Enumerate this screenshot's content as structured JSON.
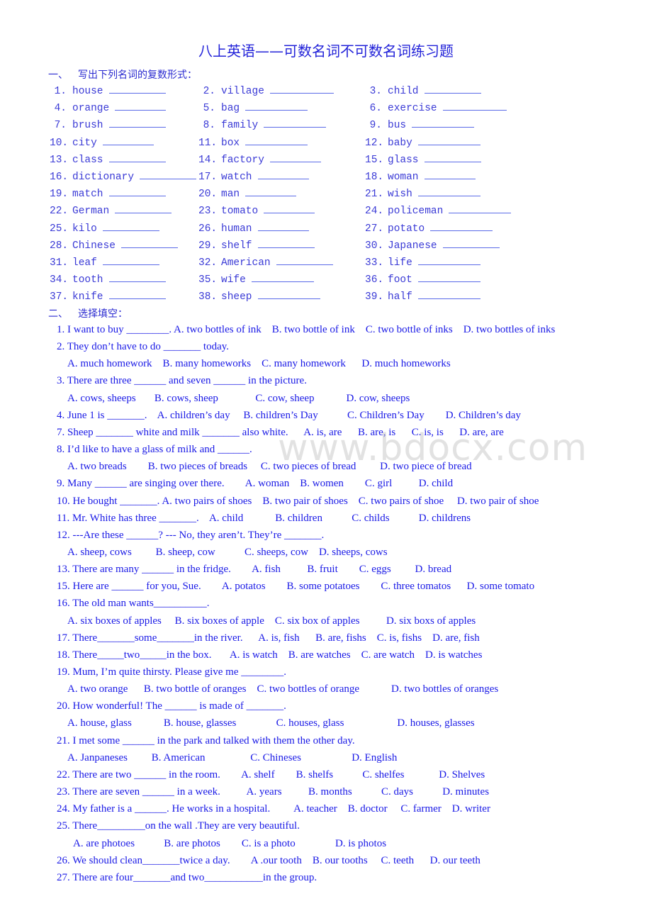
{
  "title": "八上英语——可数名词不可数名词练习题",
  "watermark": "www.bdocx.com",
  "section1": {
    "number": "一、",
    "heading": "写出下列名词的复数形式：",
    "items": [
      {
        "n": "1.",
        "word": "house"
      },
      {
        "n": "2.",
        "word": "village"
      },
      {
        "n": "3.",
        "word": "child"
      },
      {
        "n": "4.",
        "word": "orange"
      },
      {
        "n": "5.",
        "word": "bag"
      },
      {
        "n": "6.",
        "word": "exercise"
      },
      {
        "n": "7.",
        "word": "brush"
      },
      {
        "n": "8.",
        "word": "family"
      },
      {
        "n": "9.",
        "word": "bus"
      },
      {
        "n": "10.",
        "word": "city"
      },
      {
        "n": "11.",
        "word": "box"
      },
      {
        "n": "12.",
        "word": "baby"
      },
      {
        "n": "13.",
        "word": "class"
      },
      {
        "n": "14.",
        "word": "factory"
      },
      {
        "n": "15.",
        "word": "glass"
      },
      {
        "n": "16.",
        "word": "dictionary"
      },
      {
        "n": "17.",
        "word": "watch"
      },
      {
        "n": "18.",
        "word": "woman"
      },
      {
        "n": "19.",
        "word": "match"
      },
      {
        "n": "20.",
        "word": "man"
      },
      {
        "n": "21.",
        "word": "wish"
      },
      {
        "n": "22.",
        "word": "German"
      },
      {
        "n": "23.",
        "word": "tomato"
      },
      {
        "n": "24.",
        "word": "policeman"
      },
      {
        "n": "25.",
        "word": "kilo"
      },
      {
        "n": "26.",
        "word": "human"
      },
      {
        "n": "27.",
        "word": "potato"
      },
      {
        "n": "28.",
        "word": "Chinese"
      },
      {
        "n": "29.",
        "word": "shelf"
      },
      {
        "n": "30.",
        "word": "Japanese"
      },
      {
        "n": "31.",
        "word": "leaf"
      },
      {
        "n": "32.",
        "word": "American"
      },
      {
        "n": "33.",
        "word": "life"
      },
      {
        "n": "34.",
        "word": "tooth"
      },
      {
        "n": "35.",
        "word": "wife"
      },
      {
        "n": "36.",
        "word": "foot"
      },
      {
        "n": "37.",
        "word": "knife"
      },
      {
        "n": "38.",
        "word": "sheep"
      },
      {
        "n": "39.",
        "word": "half"
      }
    ]
  },
  "section2": {
    "number": "二、",
    "heading": "选择填空：",
    "lines": [
      {
        "type": "q",
        "text": "1. I want to buy ________. A. two bottles of ink    B. two bottle of ink    C. two bottle of inks    D. two bottles of inks"
      },
      {
        "type": "q",
        "text": "2. They don’t have to do _______ today."
      },
      {
        "type": "opt",
        "text": "A. much homework    B. many homeworks    C. many homework      D. much homeworks"
      },
      {
        "type": "q",
        "text": "3. There are three ______ and seven ______ in the picture."
      },
      {
        "type": "opt",
        "text": "A. cows, sheeps       B. cows, sheep              C. cow, sheep            D. cow, sheeps"
      },
      {
        "type": "q",
        "text": "4. June 1 is _______.    A. children’s day     B. children’s Day           C. Children’s Day        D. Children’s day"
      },
      {
        "type": "q",
        "text": "7. Sheep _______ white and milk _______ also white.      A. is, are      B. are, is      C. is, is      D. are, are"
      },
      {
        "type": "q",
        "text": "8. I’d like to have a glass of milk and ______."
      },
      {
        "type": "opt",
        "text": "A. two breads        B. two pieces of breads     C. two pieces of bread         D. two piece of bread"
      },
      {
        "type": "q",
        "text": "9. Many ______ are singing over there.        A. woman    B. women        C. girl          D. child"
      },
      {
        "type": "q",
        "text": "10. He bought _______. A. two pairs of shoes    B. two pair of shoes    C. two pairs of shoe     D. two pair of shoe"
      },
      {
        "type": "q",
        "text": "11. Mr. White has three _______.    A. child            B. children           C. childs           D. childrens"
      },
      {
        "type": "q",
        "text": "12. ---Are these ______? --- No, they aren’t. They’re _______."
      },
      {
        "type": "opt",
        "text": "A. sheep, cows         B. sheep, cow           C. sheeps, cow    D. sheeps, cows"
      },
      {
        "type": "q",
        "text": "13. There are many ______ in the fridge.        A. fish          B. fruit        C. eggs         D. bread"
      },
      {
        "type": "q",
        "text": "15. Here are ______ for you, Sue.        A. potatos        B. some potatoes        C. three tomatos      D. some tomato"
      },
      {
        "type": "q",
        "text": "16. The old man wants__________."
      },
      {
        "type": "opt",
        "text": "A. six boxes of apples     B. six boxes of apple    C. six box of apples          D. six boxs of apples"
      },
      {
        "type": "q",
        "text": "17. There_______some_______in the river.      A. is, fish      B. are, fishs    C. is, fishs    D. are, fish"
      },
      {
        "type": "q",
        "text": "18. There_____two_____in the box.       A. is watch    B. are watches    C. are watch    D. is watches"
      },
      {
        "type": "q",
        "text": "19. Mum, I’m quite thirsty. Please give me ________."
      },
      {
        "type": "opt",
        "text": "A. two orange      B. two bottle of oranges    C. two bottles of orange            D. two bottles of oranges"
      },
      {
        "type": "q",
        "text": "20. How wonderful! The ______ is made of _______."
      },
      {
        "type": "opt",
        "text": "A. house, glass            B. house, glasses               C. houses, glass                    D. houses, glasses"
      },
      {
        "type": "q",
        "text": "21. I met some ______ in the park and talked with them the other day."
      },
      {
        "type": "opt",
        "text": "A. Janpaneses         B. American                 C. Chineses                   D. English"
      },
      {
        "type": "q",
        "text": "22. There are two ______ in the room.        A. shelf        B. shelfs           C. shelfes             D. Shelves"
      },
      {
        "type": "q",
        "text": "23. There are seven ______ in a week.          A. years          B. months           C. days           D. minutes"
      },
      {
        "type": "q",
        "text": "24. My father is a ______. He works in a hospital.         A. teacher    B. doctor     C. farmer    D. writer"
      },
      {
        "type": "q",
        "text": "25. There_________on the wall .They are very beautiful."
      },
      {
        "type": "opt2",
        "text": "A. are photoes           B. are photos        C. is a photo               D. is photos"
      },
      {
        "type": "q",
        "text": "26. We should clean_______twice a day.        A .our tooth    B. our tooths     C. teeth      D. our teeth"
      },
      {
        "type": "q",
        "text": "27. There are four_______and two___________in the group."
      }
    ]
  }
}
